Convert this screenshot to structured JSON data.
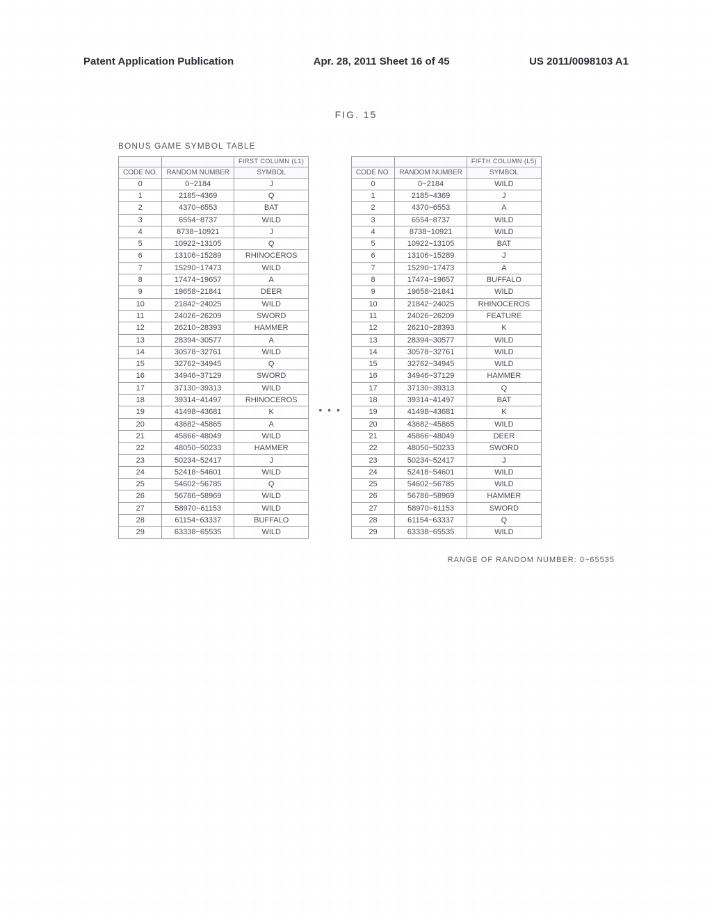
{
  "header": {
    "left": "Patent Application Publication",
    "center": "Apr. 28, 2011  Sheet 16 of 45",
    "right": "US 2011/0098103 A1"
  },
  "figure_label": "FIG. 15",
  "table_title": "BONUS GAME SYMBOL TABLE",
  "col_header_code": "CODE NO.",
  "col_header_random": "RANDOM NUMBER",
  "col_header_symbol": "SYMBOL",
  "left_table_span_label": "FIRST COLUMN (L1)",
  "right_table_span_label": "FIFTH COLUMN (L5)",
  "ellipsis": "• • •",
  "range_note": "RANGE OF RANDOM NUMBER: 0~65535",
  "chart_data": [
    {
      "type": "table",
      "title": "FIRST COLUMN (L1)",
      "columns": [
        "CODE NO.",
        "RANDOM NUMBER",
        "SYMBOL"
      ],
      "rows": [
        [
          "0",
          "0~2184",
          "J"
        ],
        [
          "1",
          "2185~4369",
          "Q"
        ],
        [
          "2",
          "4370~6553",
          "BAT"
        ],
        [
          "3",
          "6554~8737",
          "WILD"
        ],
        [
          "4",
          "8738~10921",
          "J"
        ],
        [
          "5",
          "10922~13105",
          "Q"
        ],
        [
          "6",
          "13106~15289",
          "RHINOCEROS"
        ],
        [
          "7",
          "15290~17473",
          "WILD"
        ],
        [
          "8",
          "17474~19657",
          "A"
        ],
        [
          "9",
          "19658~21841",
          "DEER"
        ],
        [
          "10",
          "21842~24025",
          "WILD"
        ],
        [
          "11",
          "24026~26209",
          "SWORD"
        ],
        [
          "12",
          "26210~28393",
          "HAMMER"
        ],
        [
          "13",
          "28394~30577",
          "A"
        ],
        [
          "14",
          "30578~32761",
          "WILD"
        ],
        [
          "15",
          "32762~34945",
          "Q"
        ],
        [
          "16",
          "34946~37129",
          "SWORD"
        ],
        [
          "17",
          "37130~39313",
          "WILD"
        ],
        [
          "18",
          "39314~41497",
          "RHINOCEROS"
        ],
        [
          "19",
          "41498~43681",
          "K"
        ],
        [
          "20",
          "43682~45865",
          "A"
        ],
        [
          "21",
          "45866~48049",
          "WILD"
        ],
        [
          "22",
          "48050~50233",
          "HAMMER"
        ],
        [
          "23",
          "50234~52417",
          "J"
        ],
        [
          "24",
          "52418~54601",
          "WILD"
        ],
        [
          "25",
          "54602~56785",
          "Q"
        ],
        [
          "26",
          "56786~58969",
          "WILD"
        ],
        [
          "27",
          "58970~61153",
          "WILD"
        ],
        [
          "28",
          "61154~63337",
          "BUFFALO"
        ],
        [
          "29",
          "63338~65535",
          "WILD"
        ]
      ]
    },
    {
      "type": "table",
      "title": "FIFTH COLUMN (L5)",
      "columns": [
        "CODE NO.",
        "RANDOM NUMBER",
        "SYMBOL"
      ],
      "rows": [
        [
          "0",
          "0~2184",
          "WILD"
        ],
        [
          "1",
          "2185~4369",
          "J"
        ],
        [
          "2",
          "4370~6553",
          "A"
        ],
        [
          "3",
          "6554~8737",
          "WILD"
        ],
        [
          "4",
          "8738~10921",
          "WILD"
        ],
        [
          "5",
          "10922~13105",
          "BAT"
        ],
        [
          "6",
          "13106~15289",
          "J"
        ],
        [
          "7",
          "15290~17473",
          "A"
        ],
        [
          "8",
          "17474~19657",
          "BUFFALO"
        ],
        [
          "9",
          "19658~21841",
          "WILD"
        ],
        [
          "10",
          "21842~24025",
          "RHINOCEROS"
        ],
        [
          "11",
          "24026~26209",
          "FEATURE"
        ],
        [
          "12",
          "26210~28393",
          "K"
        ],
        [
          "13",
          "28394~30577",
          "WILD"
        ],
        [
          "14",
          "30578~32761",
          "WILD"
        ],
        [
          "15",
          "32762~34945",
          "WILD"
        ],
        [
          "16",
          "34946~37129",
          "HAMMER"
        ],
        [
          "17",
          "37130~39313",
          "Q"
        ],
        [
          "18",
          "39314~41497",
          "BAT"
        ],
        [
          "19",
          "41498~43681",
          "K"
        ],
        [
          "20",
          "43682~45865",
          "WILD"
        ],
        [
          "21",
          "45866~48049",
          "DEER"
        ],
        [
          "22",
          "48050~50233",
          "SWORD"
        ],
        [
          "23",
          "50234~52417",
          "J"
        ],
        [
          "24",
          "52418~54601",
          "WILD"
        ],
        [
          "25",
          "54602~56785",
          "WILD"
        ],
        [
          "26",
          "56786~58969",
          "HAMMER"
        ],
        [
          "27",
          "58970~61153",
          "SWORD"
        ],
        [
          "28",
          "61154~63337",
          "Q"
        ],
        [
          "29",
          "63338~65535",
          "WILD"
        ]
      ]
    }
  ]
}
